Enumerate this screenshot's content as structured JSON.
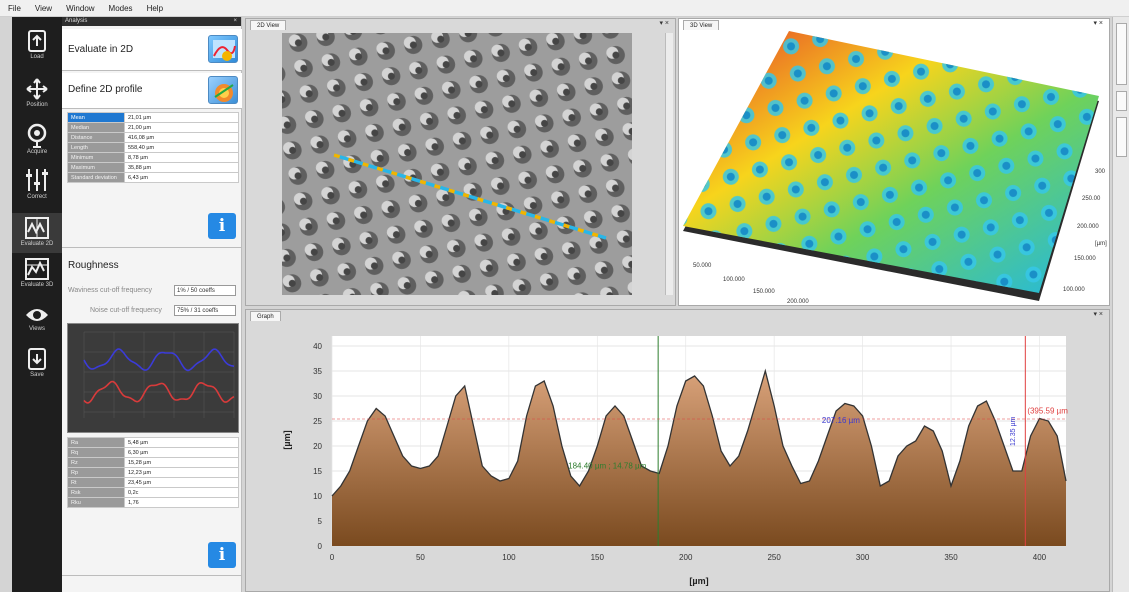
{
  "menu": [
    "File",
    "View",
    "Window",
    "Modes",
    "Help"
  ],
  "toolbar": [
    {
      "label": "Load",
      "icon": "load-icon"
    },
    {
      "label": "Position",
      "icon": "position-icon"
    },
    {
      "label": "Acquire",
      "icon": "acquire-icon"
    },
    {
      "label": "Correct",
      "icon": "correct-icon"
    },
    {
      "label": "Evaluate 2D",
      "icon": "evaluate-2d-icon",
      "active": true
    },
    {
      "label": "Evaluate 3D",
      "icon": "evaluate-3d-icon"
    },
    {
      "label": "Views",
      "icon": "views-icon"
    },
    {
      "label": "Save",
      "icon": "save-icon"
    }
  ],
  "panel": {
    "title": "Analysis",
    "evaluate_2d": "Evaluate in 2D",
    "define_profile": "Define 2D profile",
    "profile_stats": [
      {
        "key": "Mean",
        "value": "21,01 µm"
      },
      {
        "key": "Median",
        "value": "21,00 µm"
      },
      {
        "key": "Distance",
        "value": "416,08 µm"
      },
      {
        "key": "Length",
        "value": "558,40 µm"
      },
      {
        "key": "Minimum",
        "value": "8,78 µm"
      },
      {
        "key": "Maximum",
        "value": "35,88 µm"
      },
      {
        "key": "Standard deviation",
        "value": "6,43 µm"
      }
    ],
    "info": "i",
    "roughness": "Roughness",
    "waviness_label": "Waviness cut-off frequency",
    "waviness_value": "1% / 50 coeffs",
    "noise_label": "Noise cut-off frequency",
    "noise_value": "75% / 31 coeffs",
    "roughness_stats": [
      {
        "key": "Ra",
        "value": "5,48 µm"
      },
      {
        "key": "Rq",
        "value": "6,30 µm"
      },
      {
        "key": "Rz",
        "value": "15,28 µm"
      },
      {
        "key": "Rp",
        "value": "12,23 µm"
      },
      {
        "key": "Rt",
        "value": "23,45 µm"
      },
      {
        "key": "Rsk",
        "value": "0,2c"
      },
      {
        "key": "Rku",
        "value": "1,76"
      }
    ]
  },
  "views": {
    "view2d_tab": "2D View",
    "view3d_tab": "3D View",
    "graph_tab": "Graph",
    "controls": "▾ ×"
  },
  "view3d_labels": {
    "y_axis": [
      "300",
      "250.00",
      "200.000",
      "150.000",
      "100.000"
    ],
    "x_axis": [
      "50.000",
      "100.000",
      "150.000",
      "200.000"
    ],
    "unit": "[µm]"
  },
  "chart_data": {
    "type": "area",
    "x": [
      0,
      5,
      10,
      15,
      20,
      25,
      30,
      35,
      40,
      45,
      50,
      55,
      60,
      65,
      70,
      75,
      80,
      85,
      90,
      95,
      100,
      105,
      110,
      115,
      120,
      125,
      130,
      135,
      140,
      145,
      150,
      155,
      160,
      165,
      170,
      175,
      180,
      185,
      190,
      195,
      200,
      205,
      210,
      215,
      220,
      225,
      230,
      235,
      240,
      245,
      250,
      255,
      260,
      265,
      270,
      275,
      280,
      285,
      290,
      295,
      300,
      305,
      310,
      315,
      320,
      325,
      330,
      335,
      340,
      345,
      350,
      355,
      360,
      365,
      370,
      375,
      380,
      385,
      390,
      395,
      400,
      405,
      410,
      415
    ],
    "y": [
      10,
      12,
      15,
      20,
      25,
      27.5,
      26,
      22,
      18,
      16,
      15.5,
      16,
      18,
      24,
      30,
      32,
      24,
      16,
      14,
      13,
      13.5,
      17,
      26,
      32,
      33,
      28,
      20,
      14,
      12,
      15,
      20,
      26,
      28,
      26,
      21,
      16,
      15,
      14.5,
      20,
      28,
      33,
      34,
      32,
      26,
      19,
      16,
      18,
      23,
      29,
      35,
      28,
      20,
      16,
      12.5,
      13,
      17,
      22,
      27,
      28.5,
      28,
      26,
      20,
      12,
      13,
      18,
      20,
      21,
      24,
      23,
      19,
      12,
      17,
      24,
      28,
      29,
      25,
      20,
      15,
      15,
      22,
      25.5,
      25,
      22,
      13
    ],
    "xlabel": "[µm]",
    "ylabel": "[µm]",
    "xlim": [
      0,
      415
    ],
    "ylim": [
      0,
      42
    ],
    "xticks": [
      0,
      50,
      100,
      150,
      200,
      250,
      300,
      350,
      400
    ],
    "yticks": [
      0,
      5,
      10,
      15,
      20,
      25,
      30,
      35,
      40
    ],
    "grid": true,
    "markers": {
      "green_x": 184.4,
      "green_label": "184.40 µm ; 14.78 µm",
      "red_x": 392,
      "red_y": 25.4,
      "red_label": "(395.59 µm",
      "blue_label": "207.16 µm",
      "blue_vertical_label": "12.35 µm"
    },
    "colors": {
      "fill_top": "#d9a27a",
      "fill_bottom": "#7a4a1f",
      "line": "#333333",
      "marker_green": "#2e7d2e",
      "marker_red": "#e04040",
      "marker_blue": "#3a3ad0"
    }
  },
  "mini_plot": {
    "colors": {
      "blue": "#3b3bd8",
      "red": "#d83b3b"
    }
  }
}
